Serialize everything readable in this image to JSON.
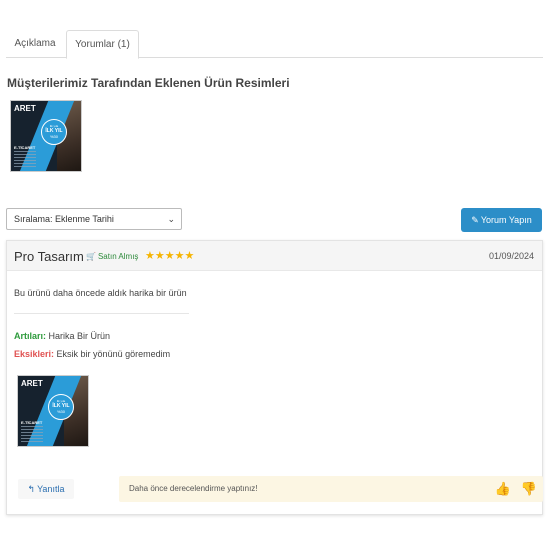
{
  "tabs": [
    {
      "label": "Açıklama"
    },
    {
      "label": "Yorumlar (1)"
    }
  ],
  "customer_images": {
    "title": "Müşterilerimiz Tarafından Eklenen Ürün Resimleri"
  },
  "product_image": {
    "brand": "ARET",
    "line1": "ilk yıla",
    "line2": "İLK YIL",
    "line3": "%30",
    "subtitle": "E-TİCARET"
  },
  "controls": {
    "sort_value": "Sıralama: Eklenme Tarihi",
    "write_review_label": "Yorum Yapın"
  },
  "review": {
    "author": "Pro Tasarım",
    "verified_label": "Satın Almış",
    "stars": "★★★★★",
    "rating": 5,
    "date": "01/09/2024",
    "text": "Bu ürünü daha öncede aldık harika bir ürün",
    "pros_label": "Artıları:",
    "pros_text": "Harika Bir Ürün",
    "cons_label": "Eksikleri:",
    "cons_text": "Eksik bir yönünü göremedim",
    "reply_label": "Yanıtla",
    "notice_text": "Daha önce derecelendirme yaptınız!"
  },
  "colors": {
    "accent": "#2c8ec8",
    "star": "#f5b400",
    "positive": "#2e9b3c",
    "negative": "#e05252",
    "notice_bg": "#fcf6e3"
  }
}
